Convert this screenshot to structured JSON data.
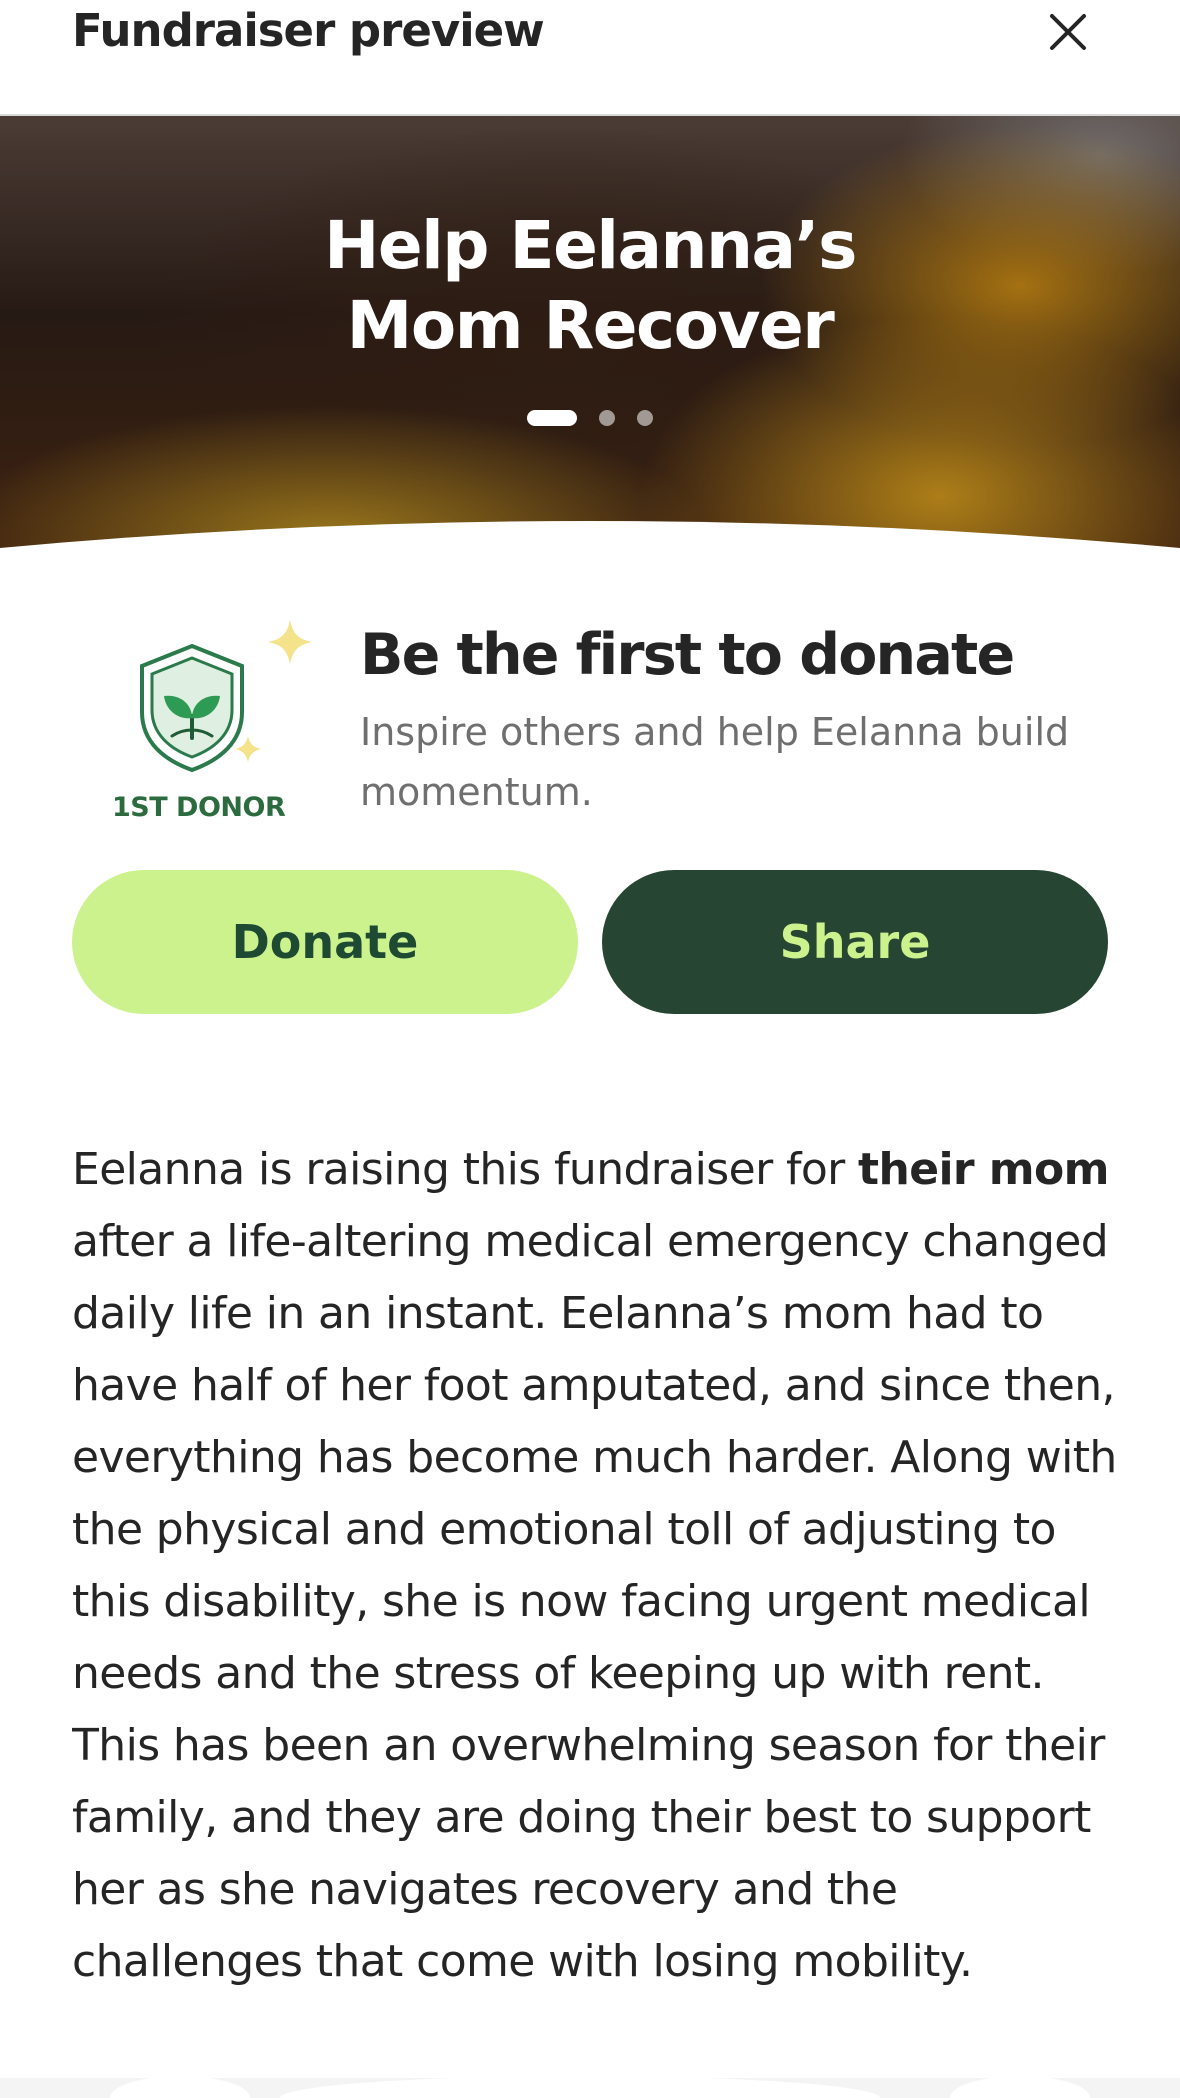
{
  "header": {
    "title": "Fundraiser preview",
    "close_icon": "close-icon"
  },
  "hero": {
    "title_line1": "Help Eelanna’s",
    "title_line2": "Mom Recover",
    "slides_total": 3,
    "active_slide": 1
  },
  "first_donor": {
    "badge_icon": "shield-sprout-icon",
    "badge_label": "1ST DONOR",
    "heading": "Be the first to donate",
    "subtext": "Inspire others and help Eelanna build momentum.",
    "colors": {
      "badge_green": "#2b6b3e",
      "sparkle": "#f4e38a"
    }
  },
  "actions": {
    "donate_label": "Donate",
    "share_label": "Share",
    "colors": {
      "donate_bg": "#cbf28d",
      "share_bg": "#264532"
    }
  },
  "story": {
    "part1": "Eelanna is raising this fundraiser for ",
    "bold": "their mom",
    "part2": " after a life-altering medical emergency changed daily life in an instant. Eelanna’s mom had to have half of her foot amputated, and since then, everything has become much harder. Along with the physical and emotional toll of adjusting to this disability, she is now facing urgent medical needs and the stress of keeping up with rent. This has been an overwhelming season for their family, and they are doing their best to support her as she navigates recovery and the challenges that come with losing mobility."
  }
}
